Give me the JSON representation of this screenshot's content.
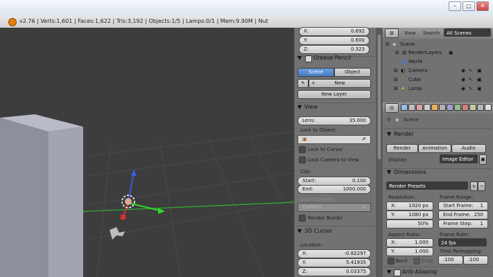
{
  "info_header": {
    "text": "v2.76 | Verts:1,601 | Faces:1,622 | Tris:3,192 | Objects:1/5 | Lamps:0/1 | Mem:9.90M | Nut"
  },
  "window_controls": {
    "minimize": "–",
    "maximize": "□",
    "close": "✕"
  },
  "n_panel": {
    "transform": {
      "x_label": "X:",
      "x_value": "0.692",
      "y_label": "Y:",
      "y_value": "0.600",
      "z_label": "Z:",
      "z_value": "0.323"
    },
    "grease_pencil": {
      "title": "Grease Pencil",
      "scene_tab": "Scene",
      "object_tab": "Object",
      "new_button": "New",
      "new_layer_button": "New Layer"
    },
    "view": {
      "title": "View",
      "lens_label": "Lens:",
      "lens_value": "35.000",
      "lock_to_object_label": "Lock to Object:",
      "lock_to_cursor": "Lock to Cursor",
      "lock_camera_to_view": "Lock Camera to View",
      "clip_label": "Clip:",
      "start_label": "Start:",
      "start_value": "0.100",
      "end_label": "End:",
      "end_value": "1000.000",
      "local_camera_label": "Local Camera:",
      "camera_field": "Camera",
      "render_border": "Render Border"
    },
    "cursor_3d": {
      "title": "3D Cursor",
      "location_label": "Location:",
      "x_label": "X:",
      "x_value": "-0.82297",
      "y_label": "Y:",
      "y_value": "5.41935",
      "z_label": "Z:",
      "z_value": "0.03375"
    }
  },
  "outliner": {
    "view_menu": "View",
    "search_menu": "Search",
    "display_mode": "All Scenes",
    "items": [
      {
        "label": "Scene"
      },
      {
        "label": "RenderLayers"
      },
      {
        "label": "World"
      },
      {
        "label": "Camera"
      },
      {
        "label": "Cube"
      },
      {
        "label": "Lamp"
      }
    ]
  },
  "properties": {
    "context": "Scene",
    "render": {
      "title": "Render",
      "render_button": "Render",
      "animation_button": "Animation",
      "audio_button": "Audio",
      "display_label": "Display:",
      "display_value": "Image Editor"
    },
    "dimensions": {
      "title": "Dimensions",
      "presets": "Render Presets",
      "resolution_label": "Resolution:",
      "res_x_label": "X:",
      "res_x_value": "1920 px",
      "res_y_label": "Y:",
      "res_y_value": "1080 px",
      "res_percent": "50%",
      "frame_range_label": "Frame Range:",
      "start_frame_label": "Start Frame:",
      "start_frame_value": "1",
      "end_frame_label": "End Frame:",
      "end_frame_value": "250",
      "frame_step_label": "Frame Step:",
      "frame_step_value": "1",
      "aspect_label": "Aspect Ratio:",
      "aspect_x_label": "X:",
      "aspect_x_value": "1.000",
      "aspect_y_label": "Y:",
      "aspect_y_value": "1.000",
      "frame_rate_label": "Frame Rate:",
      "frame_rate_value": "24 fps",
      "time_remap_label": "Time Remapping:",
      "remap_old": ":100",
      "remap_new": ":100",
      "border_label": "Bord",
      "crop_label": "Crop"
    },
    "anti_aliasing": {
      "title": "Anti-Aliasing"
    }
  },
  "colors": {
    "viewport_bg": "#3d3d3d",
    "panel_bg": "#727272",
    "accent_blue": "#4a7bc4",
    "grid_green": "#2fb52f",
    "axis_red": "#c83030"
  }
}
